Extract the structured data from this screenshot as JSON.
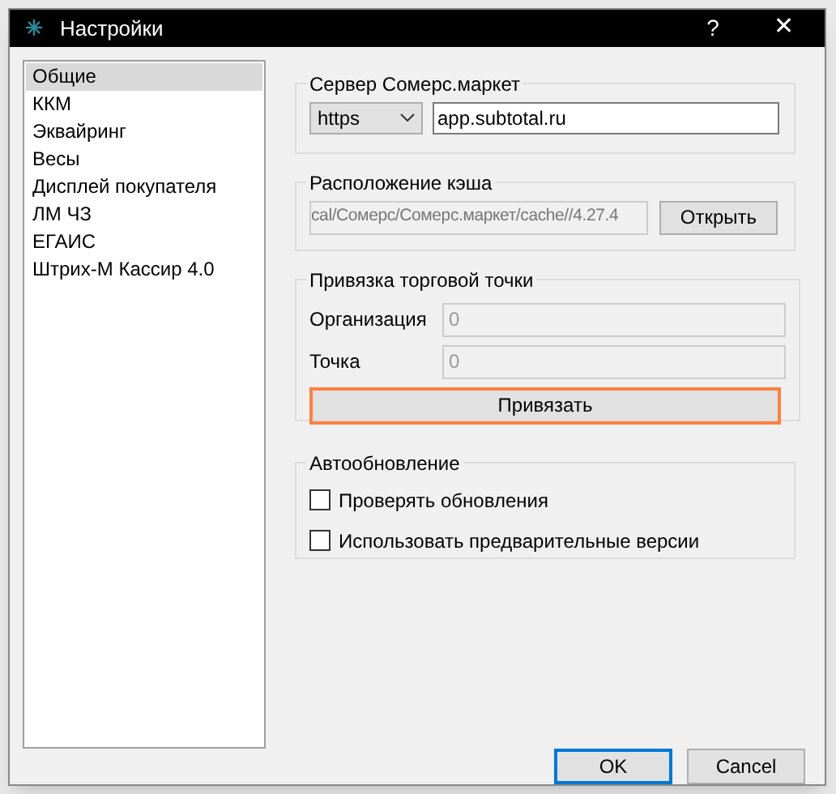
{
  "window": {
    "title": "Настройки",
    "help": "?",
    "close": "✕"
  },
  "sidebar": {
    "items": [
      {
        "label": "Общие",
        "selected": true
      },
      {
        "label": "ККМ",
        "selected": false
      },
      {
        "label": "Эквайринг",
        "selected": false
      },
      {
        "label": "Весы",
        "selected": false
      },
      {
        "label": "Дисплей покупателя",
        "selected": false
      },
      {
        "label": "ЛМ ЧЗ",
        "selected": false
      },
      {
        "label": "ЕГАИС",
        "selected": false
      },
      {
        "label": "Штрих-М Кассир 4.0",
        "selected": false
      }
    ]
  },
  "server": {
    "title": "Сервер Сомерс.маркет",
    "protocol": "https",
    "address": "app.subtotal.ru"
  },
  "cache": {
    "title": "Расположение кэша",
    "path": "cal/Сомерс/Сомерс.маркет/cache//4.27.4",
    "button": "Открыть"
  },
  "binding": {
    "title": "Привязка торговой точки",
    "fields": [
      {
        "label": "Организация",
        "value": "0"
      },
      {
        "label": "Точка",
        "value": "0"
      }
    ],
    "button": "Привязать",
    "button_focused": true
  },
  "autoupdate": {
    "title": "Автообновление",
    "options": [
      {
        "label": "Проверять обновления",
        "checked": false
      },
      {
        "label": "Использовать предварительные версии",
        "checked": false
      }
    ]
  },
  "buttons": [
    {
      "label": "OK",
      "default": true
    },
    {
      "label": "Cancel",
      "default": false
    }
  ]
}
